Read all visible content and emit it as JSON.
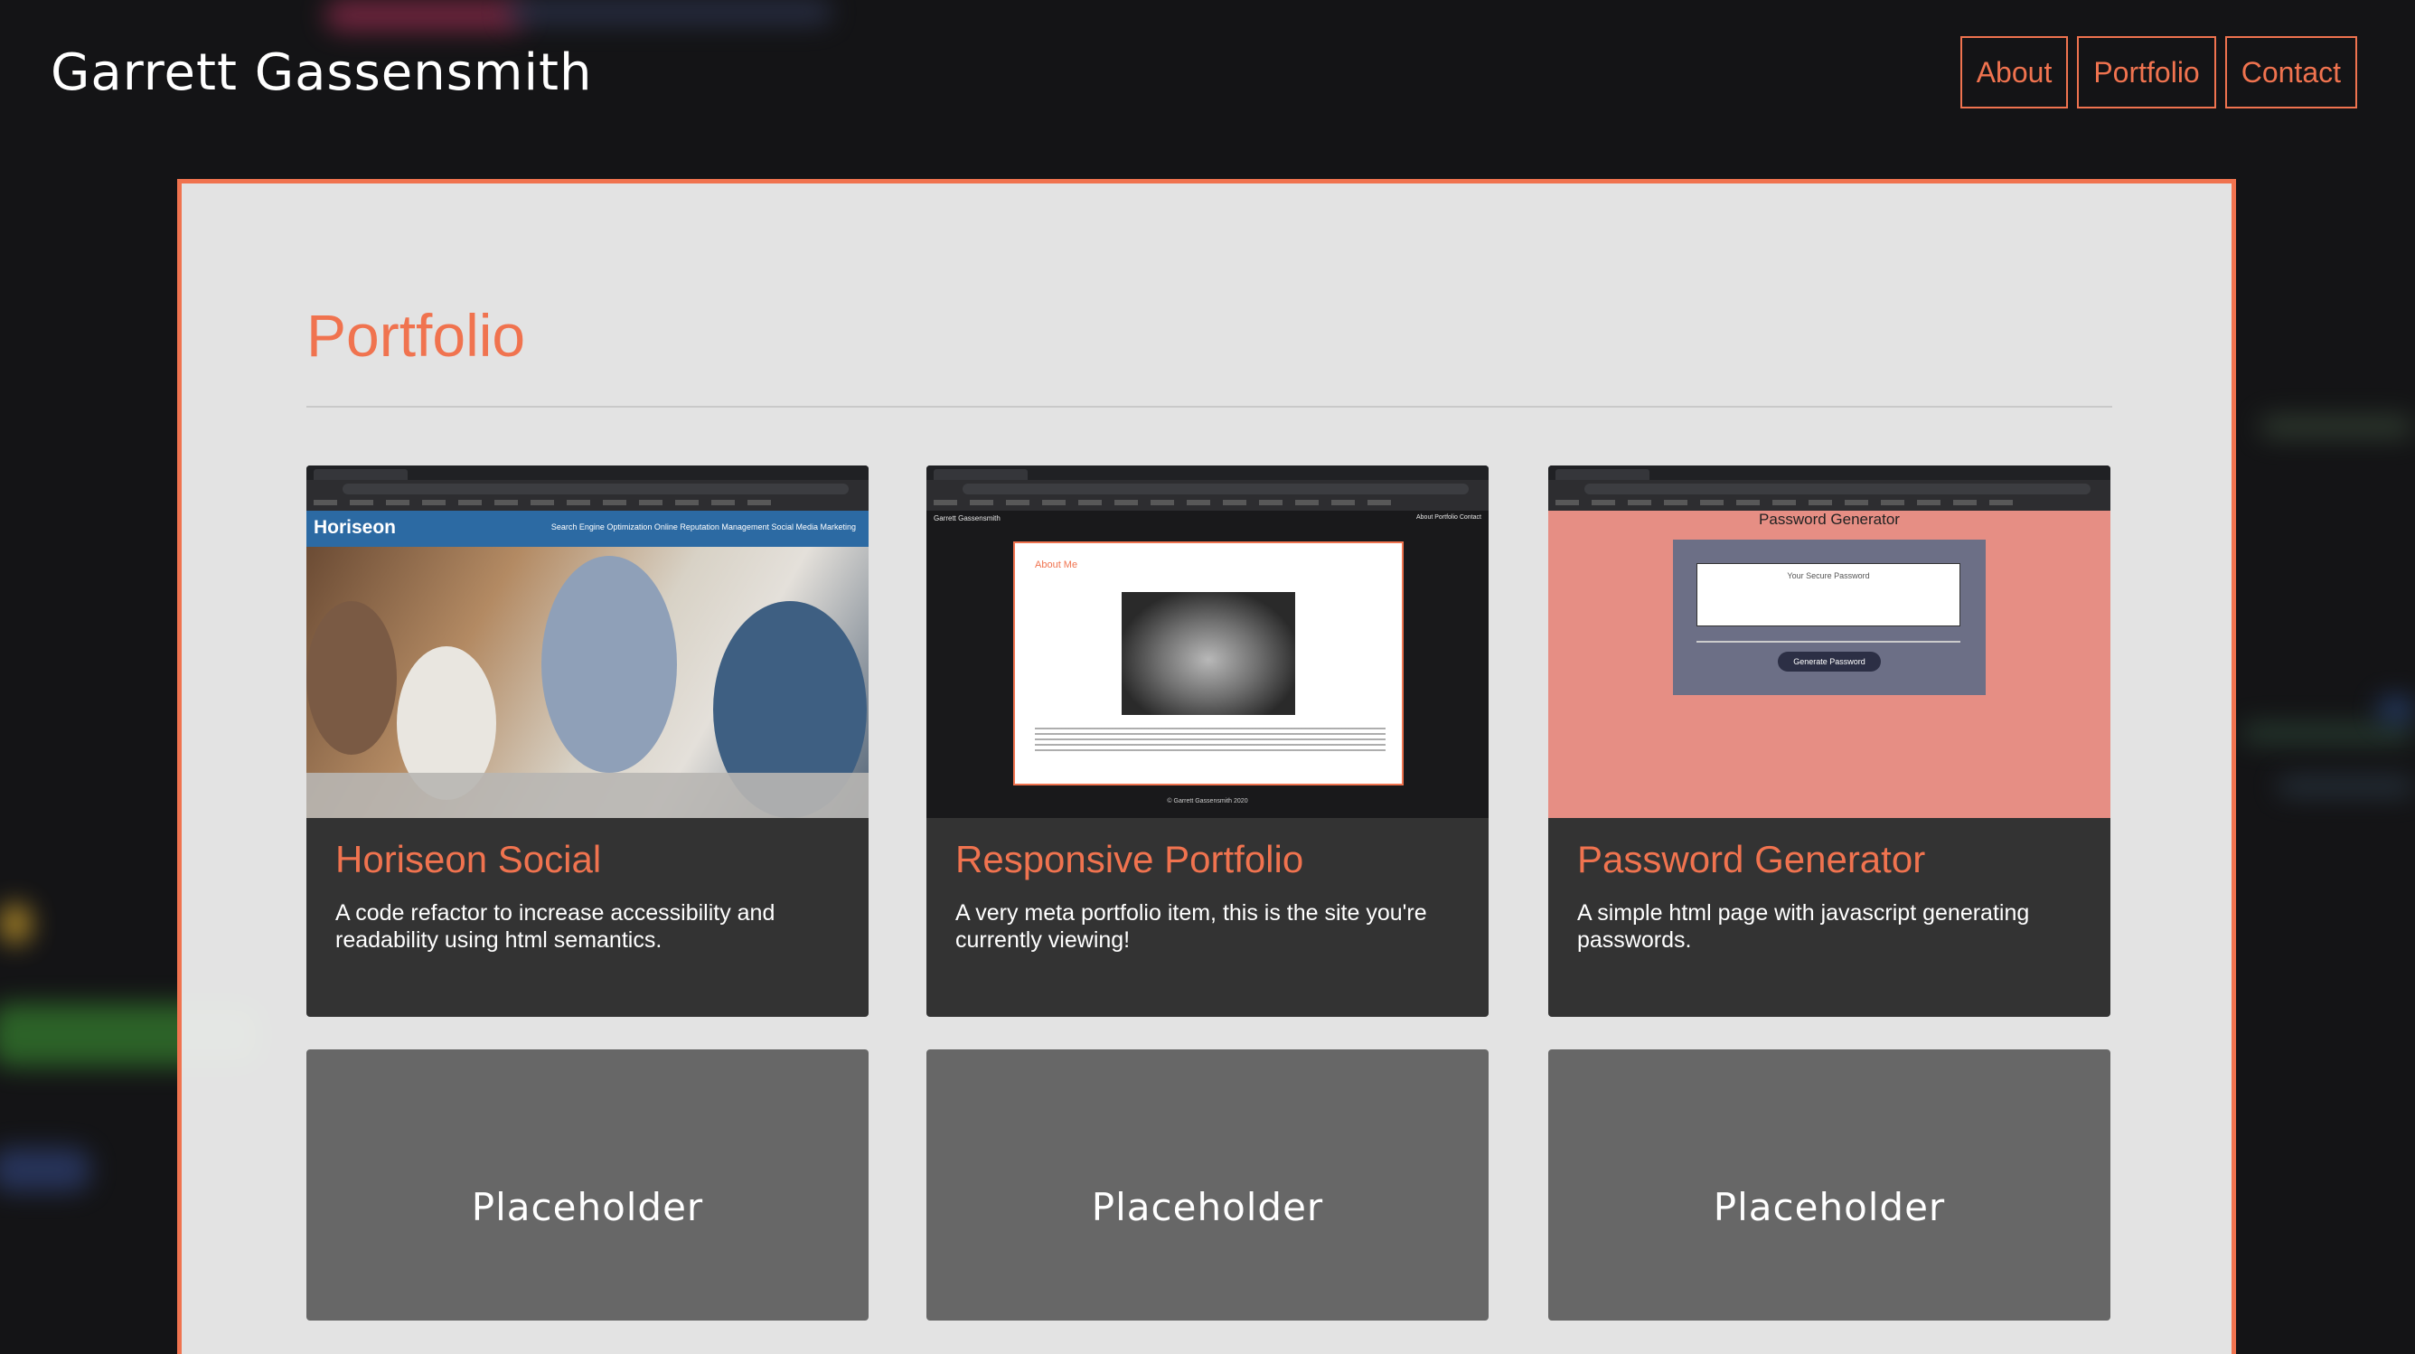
{
  "header": {
    "site_title": "Garrett Gassensmith",
    "nav": [
      "About",
      "Portfolio",
      "Contact"
    ]
  },
  "main": {
    "section_title": "Portfolio",
    "projects": [
      {
        "title": "Horiseon Social",
        "description": "A code refactor to increase accessibility and readability using html semantics.",
        "screenshot": {
          "brand": "Horiseon",
          "menu": "Search Engine Optimization     Online Reputation Management     Social Media Marketing"
        }
      },
      {
        "title": "Responsive Portfolio",
        "description": "A very meta portfolio item, this is the site you're currently viewing!",
        "screenshot": {
          "header": "Garrett Gassensmith",
          "nav": "About   Portfolio   Contact",
          "section": "About Me",
          "footer": "© Garrett Gassensmith 2020"
        }
      },
      {
        "title": "Password Generator",
        "description": "A simple html page with javascript generating passwords.",
        "screenshot": {
          "title": "Password Generator",
          "placeholder": "Your Secure Password",
          "button": "Generate Password"
        }
      }
    ],
    "placeholders": [
      "Placeholder",
      "Placeholder",
      "Placeholder"
    ]
  },
  "colors": {
    "accent": "#f0734f",
    "page_background": "#141416",
    "card_background": "#333333",
    "placeholder_background": "#676767",
    "content_background": "#eeeeee"
  }
}
